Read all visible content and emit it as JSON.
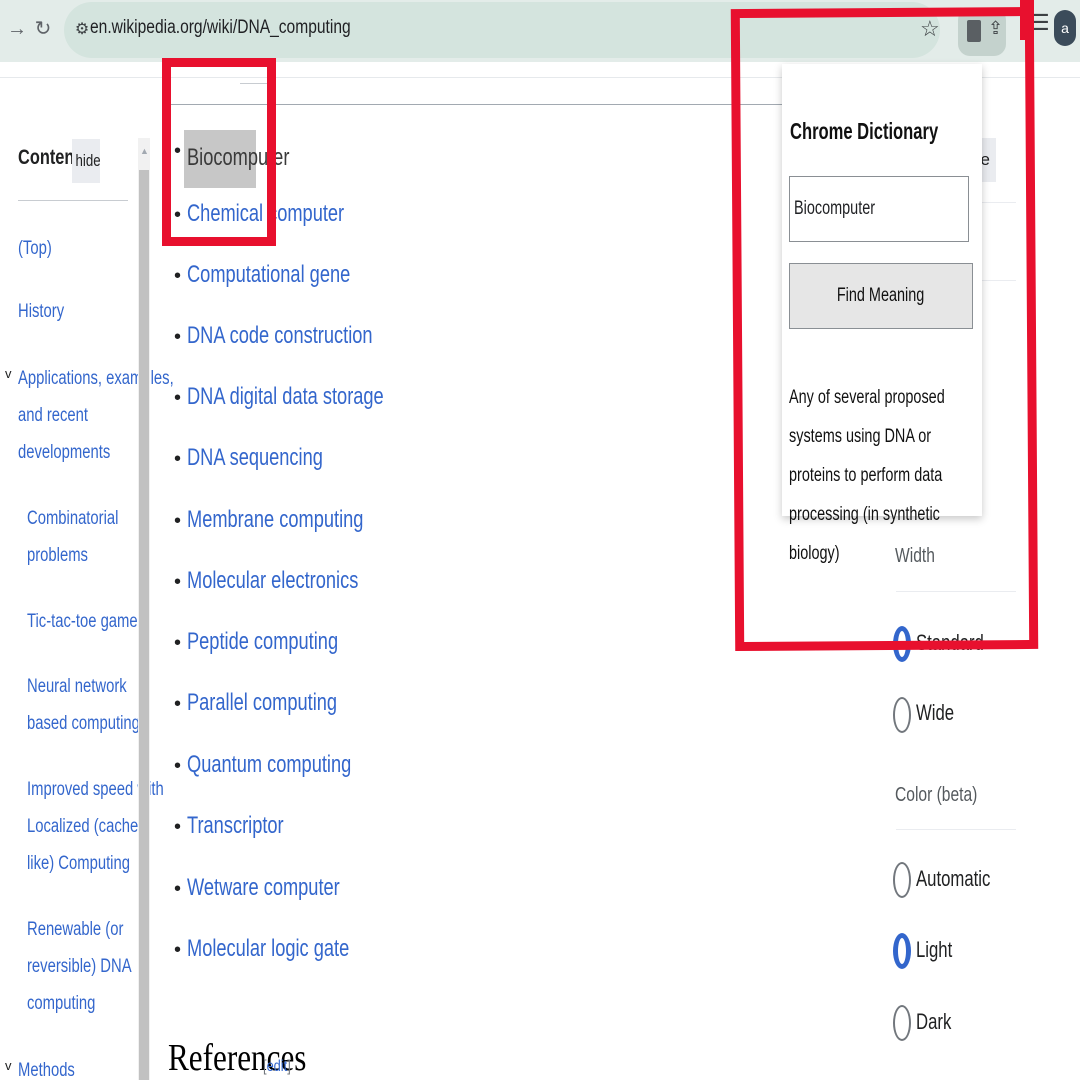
{
  "browser": {
    "url": "en.wikipedia.org/wiki/DNA_computing",
    "profile_initial": "a",
    "icons": {
      "forward": "arrow-forward-icon",
      "reload": "reload-icon",
      "site_settings": "tune-icon",
      "bookmark": "star-icon",
      "extension": "dictionary-extension-icon",
      "share": "share-icon",
      "menu": "chrome-menu-icon"
    }
  },
  "toc": {
    "title": "Contents",
    "hide_label": "hide",
    "items": [
      {
        "lines": [
          "(Top)"
        ]
      },
      {
        "lines": [
          "History"
        ]
      },
      {
        "lines": [
          "Applications, examples,",
          "and recent",
          "developments"
        ],
        "caret": "v"
      },
      {
        "lines": [
          "Combinatorial",
          "problems"
        ]
      },
      {
        "lines": [
          "Tic-tac-toe game"
        ]
      },
      {
        "lines": [
          "Neural network",
          "based computing"
        ]
      },
      {
        "lines": [
          "Improved speed with",
          "Localized (cache-",
          "like) Computing"
        ]
      },
      {
        "lines": [
          "Renewable (or",
          "reversible) DNA",
          "computing"
        ]
      },
      {
        "lines": [
          "Methods"
        ],
        "caret": "v"
      }
    ]
  },
  "see_also": [
    "Biocomputer",
    "Chemical computer",
    "Computational gene",
    "DNA code construction",
    "DNA digital data storage",
    "DNA sequencing",
    "Membrane computing",
    "Molecular electronics",
    "Peptide computing",
    "Parallel computing",
    "Quantum computing",
    "Transcriptor",
    "Wetware computer",
    "Molecular logic gate"
  ],
  "references": {
    "heading": "References",
    "edit_open": "[",
    "edit_label": "edit",
    "edit_close": "]"
  },
  "appearance": {
    "hide_fragment": "e",
    "width_label": "Width",
    "width_options": [
      {
        "label": "Standard",
        "selected": true
      },
      {
        "label": "Wide",
        "selected": false
      }
    ],
    "color_label": "Color (beta)",
    "color_options": [
      {
        "label": "Automatic",
        "selected": false
      },
      {
        "label": "Light",
        "selected": true
      },
      {
        "label": "Dark",
        "selected": false
      }
    ]
  },
  "dictionary": {
    "title": "Chrome Dictionary",
    "input_value": "Biocomputer",
    "button_label": "Find Meaning",
    "definition": "Any of several proposed systems using DNA or proteins to perform data processing (in synthetic biology)"
  },
  "colors": {
    "link": "#3366cc",
    "annotation": "#e8102e",
    "toolbar_bg": "#e3ece9"
  }
}
